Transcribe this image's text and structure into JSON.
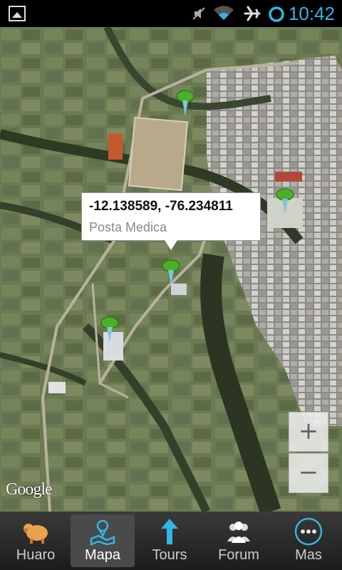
{
  "status_bar": {
    "time": "10:42",
    "icons": [
      "gallery-icon",
      "mute-icon",
      "wifi-icon",
      "airplane-mode-icon",
      "sync-icon"
    ]
  },
  "map": {
    "attribution": "Google",
    "callout": {
      "coords": "-12.138589, -76.234811",
      "place": "Posta Medica"
    },
    "zoom_in_label": "+",
    "zoom_out_label": "−",
    "pins": [
      "pin-top",
      "pin-right",
      "pin-center",
      "pin-left"
    ]
  },
  "tabs": [
    {
      "label": "Huaro",
      "icon": "pig-icon"
    },
    {
      "label": "Mapa",
      "icon": "map-icon",
      "active": true
    },
    {
      "label": "Tours",
      "icon": "arrow-up-icon"
    },
    {
      "label": "Forum",
      "icon": "people-icon"
    },
    {
      "label": "Mas",
      "icon": "more-icon"
    }
  ],
  "colors": {
    "accent": "#33b5e5",
    "pin": "#4caf2a"
  }
}
